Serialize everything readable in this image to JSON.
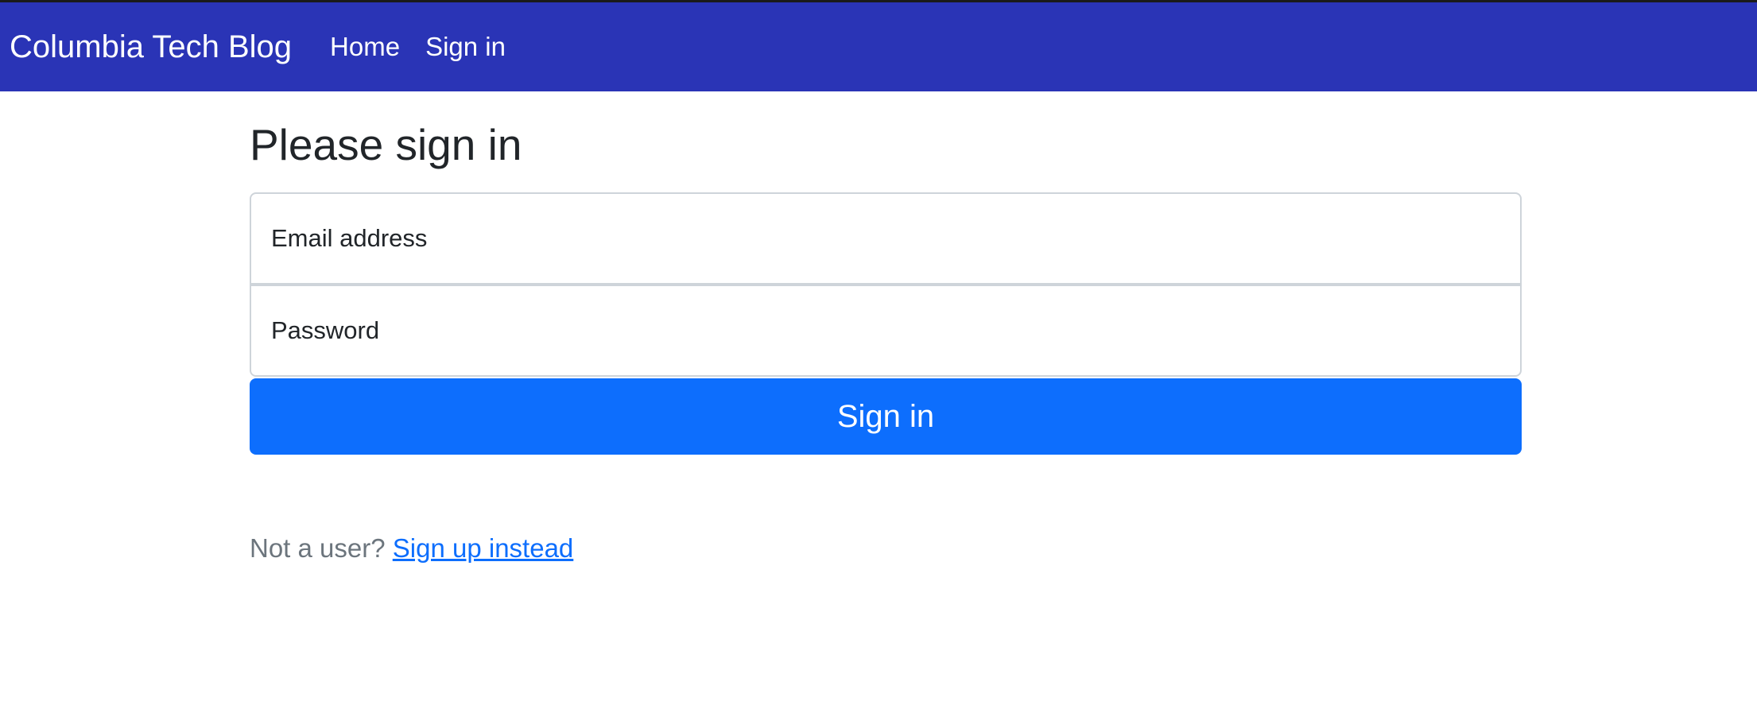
{
  "navbar": {
    "brand": "Columbia Tech Blog",
    "links": [
      {
        "label": "Home"
      },
      {
        "label": "Sign in"
      }
    ],
    "background": "#2a34b6"
  },
  "main": {
    "title": "Please sign in",
    "email": {
      "label": "Email address"
    },
    "password": {
      "label": "Password"
    },
    "submit_label": "Sign in",
    "signup_prompt": "Not a user?",
    "signup_link": "Sign up instead"
  },
  "colors": {
    "primary": "#0d6efd",
    "muted_text": "#6c757d",
    "heading_text": "#212529",
    "input_border": "#ced4da"
  }
}
